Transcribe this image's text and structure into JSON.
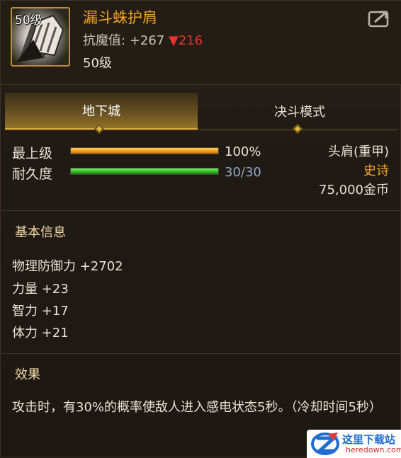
{
  "item": {
    "icon_level": "50级",
    "name": "漏斗蛛护肩",
    "magic_resist_label": "抗魔值:",
    "magic_resist_value": "+267",
    "magic_resist_down": "▼216",
    "req_level": "50级",
    "icon_name": "shoulder-armor-icon"
  },
  "share_icon": "share-icon",
  "tabs": [
    {
      "label": "地下城",
      "active": true
    },
    {
      "label": "决斗模式",
      "active": false
    }
  ],
  "bars": {
    "quality_label": "最上级",
    "quality_fraction": 1.0,
    "quality_value": "100%",
    "durability_label": "耐久度",
    "durability_fraction": 1.0,
    "durability_value": "30/30"
  },
  "info": {
    "type": "头肩(重甲)",
    "rarity": "史诗",
    "price": "75,000金币"
  },
  "basic": {
    "title": "基本信息",
    "attrs": [
      "物理防御力 +2702",
      "力量 +23",
      "智力 +17",
      "体力 +21"
    ]
  },
  "effect": {
    "title": "效果",
    "text": "攻击时，有30%的概率使敌人进入感电状态5秒。（冷却时间5秒）"
  },
  "watermark": {
    "line1": "这里下载站",
    "line2": "heredown.com"
  },
  "colors": {
    "rarity_orange": "#f0a320",
    "down_red": "#e8322c",
    "durability_blue": "#8aa8c8"
  }
}
